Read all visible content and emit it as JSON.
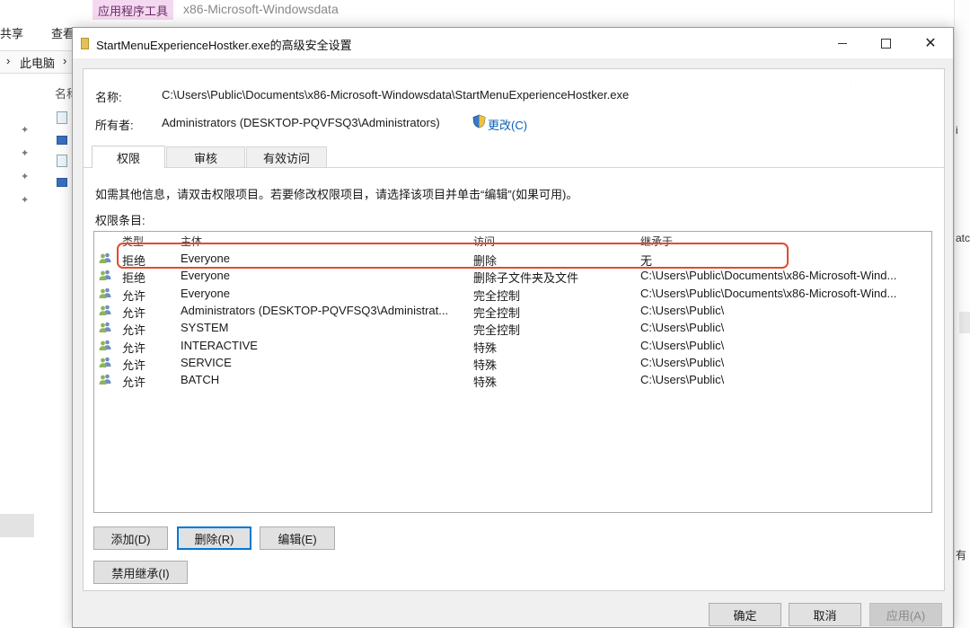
{
  "explorer": {
    "ribbon_tab": "应用程序工具",
    "title": "x86-Microsoft-Windowsdata",
    "menu": {
      "share": "共享",
      "view": "查看"
    },
    "address": "此电脑",
    "column_name": "名称",
    "right_edge": {
      "top": "i",
      "mid": "atc",
      "bottom": "有"
    }
  },
  "dialog": {
    "title": "StartMenuExperienceHostker.exe的高级安全设置",
    "name_label": "名称:",
    "name_value": "C:\\Users\\Public\\Documents\\x86-Microsoft-Windowsdata\\StartMenuExperienceHostker.exe",
    "owner_label": "所有者:",
    "owner_value": "Administrators (DESKTOP-PQVFSQ3\\Administrators)",
    "change_link": "更改(C)",
    "tabs": [
      {
        "label": "权限"
      },
      {
        "label": "审核"
      },
      {
        "label": "有效访问"
      }
    ],
    "info_text": "如需其他信息，请双击权限项目。若要修改权限项目，请选择该项目并单击“编辑”(如果可用)。",
    "entries_label": "权限条目:",
    "columns": {
      "type": "类型",
      "principal": "主体",
      "access": "访问",
      "inherit": "继承于"
    },
    "rows": [
      {
        "type": "拒绝",
        "principal": "Everyone",
        "access": "删除",
        "inherit": "无"
      },
      {
        "type": "拒绝",
        "principal": "Everyone",
        "access": "删除子文件夹及文件",
        "inherit": "C:\\Users\\Public\\Documents\\x86-Microsoft-Wind..."
      },
      {
        "type": "允许",
        "principal": "Everyone",
        "access": "完全控制",
        "inherit": "C:\\Users\\Public\\Documents\\x86-Microsoft-Wind..."
      },
      {
        "type": "允许",
        "principal": "Administrators (DESKTOP-PQVFSQ3\\Administrat...",
        "access": "完全控制",
        "inherit": "C:\\Users\\Public\\"
      },
      {
        "type": "允许",
        "principal": "SYSTEM",
        "access": "完全控制",
        "inherit": "C:\\Users\\Public\\"
      },
      {
        "type": "允许",
        "principal": "INTERACTIVE",
        "access": "特殊",
        "inherit": "C:\\Users\\Public\\"
      },
      {
        "type": "允许",
        "principal": "SERVICE",
        "access": "特殊",
        "inherit": "C:\\Users\\Public\\"
      },
      {
        "type": "允许",
        "principal": "BATCH",
        "access": "特殊",
        "inherit": "C:\\Users\\Public\\"
      }
    ],
    "buttons": {
      "add": "添加(D)",
      "remove": "删除(R)",
      "edit": "编辑(E)",
      "disable_inheritance": "禁用继承(I)",
      "ok": "确定",
      "cancel": "取消",
      "apply": "应用(A)"
    },
    "colors": {
      "highlight": "#e24a2f",
      "link": "#0a5fb8",
      "accent": "#0078d7"
    }
  }
}
